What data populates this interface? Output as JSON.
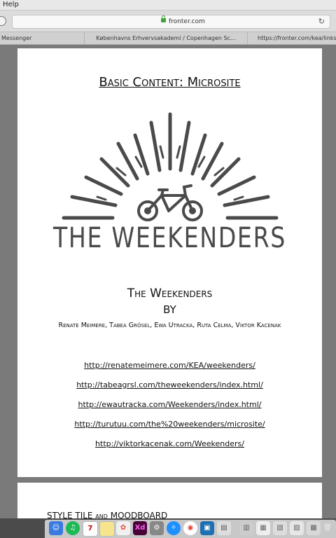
{
  "menubar": {
    "help_label": "Help"
  },
  "browser": {
    "url": "fronter.com",
    "tabs": [
      {
        "label": "Messenger"
      },
      {
        "label": "Københavns Erhvervsakademi / Copenhagen Sc..."
      },
      {
        "label": "https://fronter.com/kea/links/f"
      }
    ]
  },
  "document": {
    "title": "Basic Content:  Microsite",
    "logo_text": "THE WEEKENDERS",
    "heading": "The Weekenders",
    "by": "BY",
    "authors": "Renate Meimere, Tabea Grösel, Ewa Utracka, Ruta Celma, Viktor Kacenak",
    "links": [
      "http://renatemeimere.com/KEA/weekenders/",
      "http://tabeagrsl.com/theweekenders/index.html/",
      "http://ewautracka.com/Weekenders/index.html/",
      "http://turutuu.com/the%20weekenders/microsite/",
      "http://viktorkacenak.com/Weekenders/"
    ],
    "next_page_heading": "STYLE TILE and MOODBOARD"
  },
  "dock": {
    "calendar_day": "7"
  },
  "colors": {
    "logo": "#4a4a4a",
    "lock": "#44a13a"
  }
}
